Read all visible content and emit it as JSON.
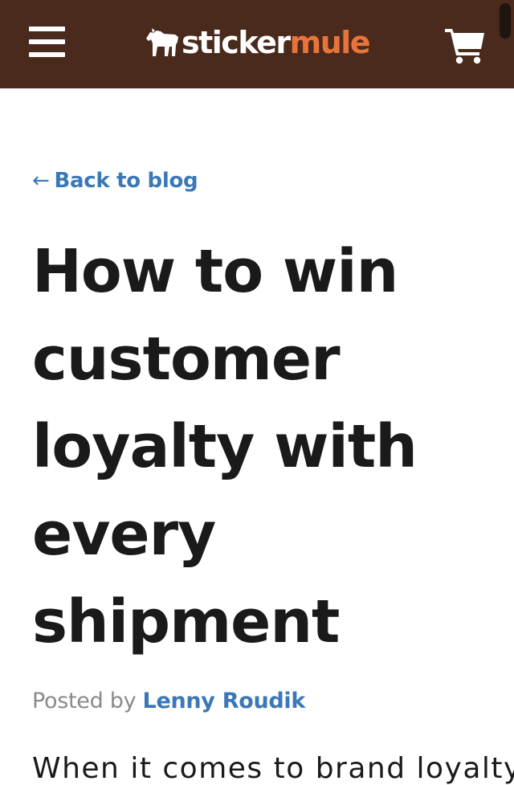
{
  "header": {
    "logo": {
      "text_main": "sticker",
      "text_accent": "mule"
    },
    "menu_icon": "hamburger-menu-icon",
    "cart_icon": "shopping-cart-icon",
    "colors": {
      "background": "#4a2a1c",
      "accent": "#e8743b"
    }
  },
  "nav": {
    "back_arrow": "←",
    "back_label": "Back to blog"
  },
  "article": {
    "title": "How to win customer loyalty with every shipment",
    "posted_by_label": "Posted by",
    "author": "Lenny Roudik",
    "first_line_partial": "When it comes to brand loyalty,"
  },
  "colors": {
    "link": "#3a78b8",
    "text": "#1a1a1a",
    "muted": "#8a8a8a"
  }
}
